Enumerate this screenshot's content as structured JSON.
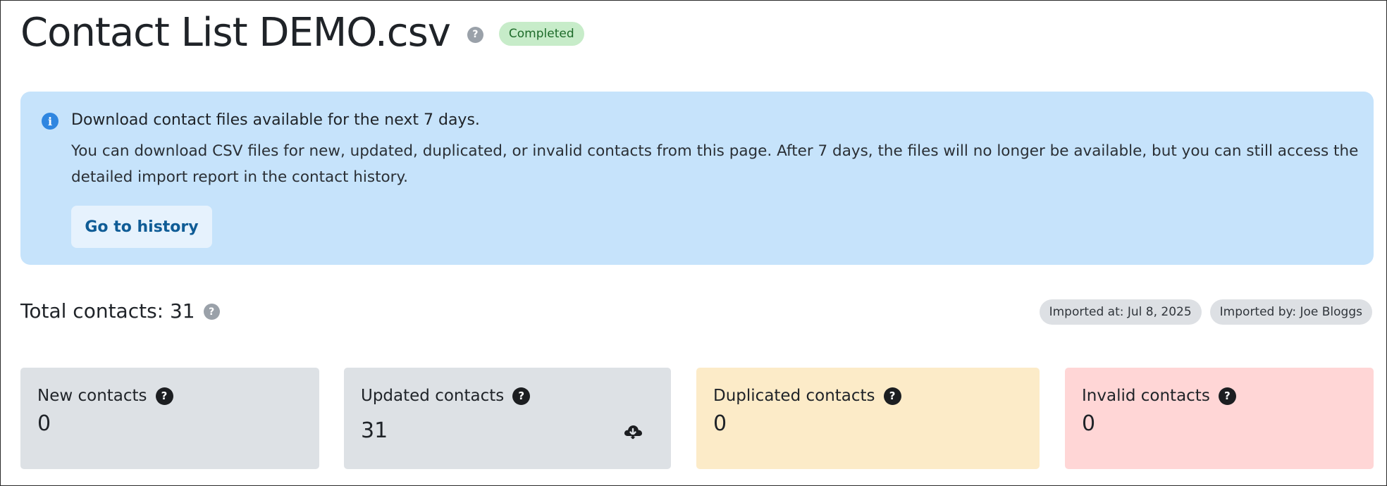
{
  "header": {
    "title": "Contact List DEMO.csv",
    "help_icon": "question-icon",
    "status": "Completed",
    "status_color": "#c7ecc9"
  },
  "banner": {
    "icon": "info-icon",
    "title": "Download contact files available for the next 7 days.",
    "body": "You can download CSV files for new, updated, duplicated, or invalid contacts from this page. After 7 days, the files will no longer be available, but you can still access the detailed import report in the contact history.",
    "button_label": "Go to history",
    "background": "#c6e3fb"
  },
  "summary": {
    "total_label": "Total contacts: 31",
    "imported_at": "Imported at: Jul 8, 2025",
    "imported_by": "Imported by: Joe Bloggs"
  },
  "cards": [
    {
      "label": "New contacts",
      "value": "0",
      "color": "#dde1e5"
    },
    {
      "label": "Updated contacts",
      "value": "31",
      "color": "#dde1e5",
      "action_icon": "cloud-download-icon"
    },
    {
      "label": "Duplicated contacts",
      "value": "0",
      "color": "#fcebc8"
    },
    {
      "label": "Invalid contacts",
      "value": "0",
      "color": "#ffd6d6"
    }
  ]
}
